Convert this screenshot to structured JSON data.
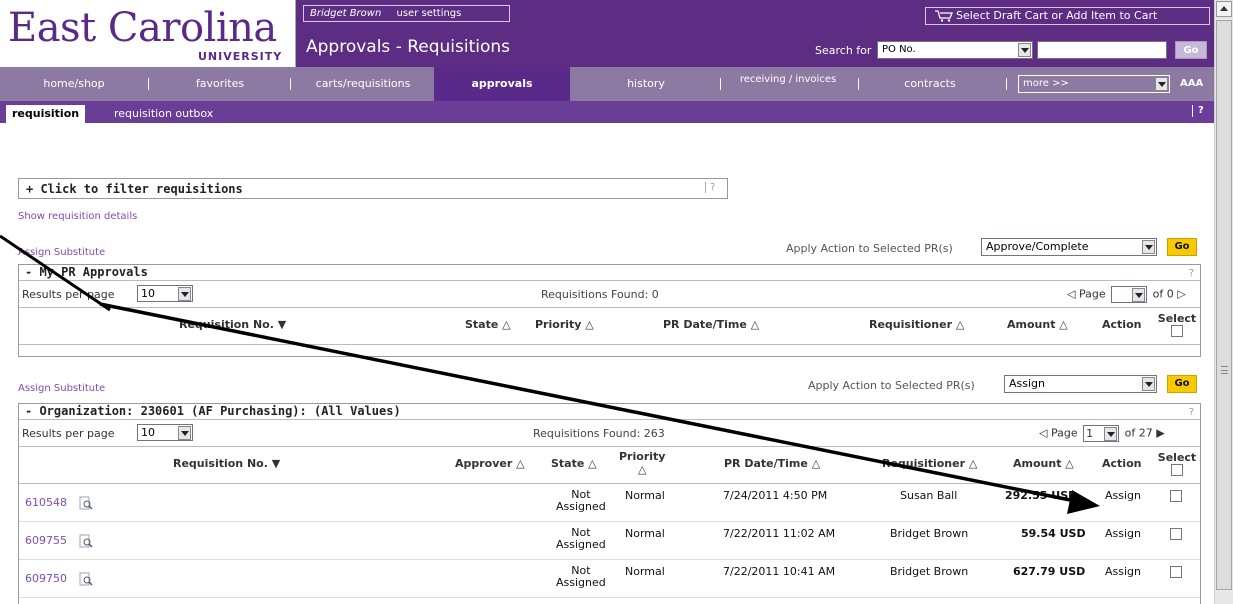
{
  "header": {
    "logo_main": "East Carolina",
    "logo_sub": "UNIVERSITY",
    "user_name": "Bridget Brown",
    "user_settings": "user settings",
    "page_title": "Approvals - Requisitions",
    "cart_label": "Select Draft Cart or Add Item to Cart",
    "search_label": "Search for",
    "search_type": "PO No.",
    "search_value": "",
    "search_go": "Go"
  },
  "nav": {
    "items": [
      "home/shop",
      "favorites",
      "carts/requisitions",
      "approvals",
      "history",
      "receiving / invoices",
      "contracts"
    ],
    "more": "more >>",
    "text_size": "AAA",
    "active": "approvals"
  },
  "subtabs": {
    "items": [
      "requisition",
      "requisition outbox"
    ],
    "help": "?"
  },
  "filter": {
    "label": "+ Click to filter requisitions",
    "help": "?",
    "show_details": "Show requisition details"
  },
  "section1": {
    "assign_substitute": "Assign Substitute",
    "apply_label": "Apply Action to Selected PR(s)",
    "apply_action": "Approve/Complete",
    "go": "Go",
    "title": "- My PR Approvals",
    "help": "?",
    "results_per_page_label": "Results per page",
    "results_per_page": "10",
    "found": "Requisitions Found: 0",
    "page_label": "Page",
    "page_value": "",
    "page_of": "of 0",
    "columns": [
      "Requisition No.",
      "State",
      "Priority",
      "PR Date/Time",
      "Requisitioner",
      "Amount",
      "Action",
      "Select"
    ]
  },
  "section2": {
    "assign_substitute": "Assign Substitute",
    "apply_label": "Apply Action to Selected PR(s)",
    "apply_action": "Assign",
    "go": "Go",
    "title": "- Organization: 230601 (AF Purchasing): (All Values)",
    "help": "?",
    "results_per_page_label": "Results per page",
    "results_per_page": "10",
    "found": "Requisitions Found: 263",
    "page_label": "Page",
    "page_value": "1",
    "page_of": "of 27",
    "columns": [
      "Requisition No.",
      "Approver",
      "State",
      "Priority",
      "PR Date/Time",
      "Requisitioner",
      "Amount",
      "Action",
      "Select"
    ],
    "rows": [
      {
        "req_no": "610548",
        "state_line1": "Not",
        "state_line2": "Assigned",
        "priority": "Normal",
        "date": "7/24/2011 4:50 PM",
        "requisitioner": "Susan Ball",
        "amount": "292.55 USD",
        "action": "Assign"
      },
      {
        "req_no": "609755",
        "state_line1": "Not",
        "state_line2": "Assigned",
        "priority": "Normal",
        "date": "7/22/2011 11:02 AM",
        "requisitioner": "Bridget Brown",
        "amount": "59.54 USD",
        "action": "Assign"
      },
      {
        "req_no": "609750",
        "state_line1": "Not",
        "state_line2": "Assigned",
        "priority": "Normal",
        "date": "7/22/2011 10:41 AM",
        "requisitioner": "Bridget Brown",
        "amount": "627.79 USD",
        "action": "Assign"
      }
    ]
  },
  "colors": {
    "header_purple": "#5c2d82",
    "nav_gray_purple": "#8d7aa3",
    "link_purple": "#7d4cb3",
    "go_yellow": "#f7c900"
  }
}
